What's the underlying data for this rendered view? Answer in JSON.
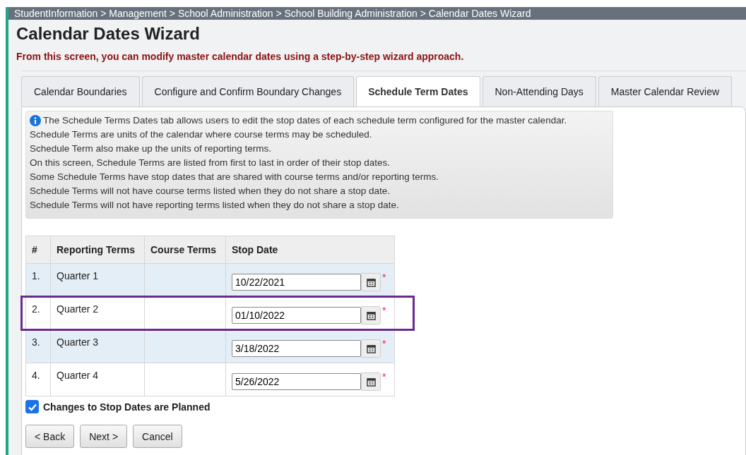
{
  "breadcrumb": "StudentInformation > Management > School Administration > School Building Administration > Calendar Dates Wizard",
  "title": "Calendar Dates Wizard",
  "subtitle": "From this screen, you can modify master calendar dates using a step-by-step wizard approach.",
  "tabs": [
    {
      "label": "Calendar Boundaries",
      "selected": false
    },
    {
      "label": "Configure and Confirm Boundary Changes",
      "selected": false
    },
    {
      "label": "Schedule Term Dates",
      "selected": true
    },
    {
      "label": "Non-Attending Days",
      "selected": false
    },
    {
      "label": "Master Calendar Review",
      "selected": false
    }
  ],
  "info_lines": [
    "The Schedule Terms Dates tab allows users to edit the stop dates of each schedule term configured for the master calendar.",
    "Schedule Terms are units of the calendar where course terms may be scheduled.",
    "Schedule Term also make up the units of reporting terms.",
    "On this screen, Schedule Terms are listed from first to last in order of their stop dates.",
    "Some Schedule Terms have stop dates that are shared with course terms and/or reporting terms.",
    "Schedule Terms will not have course terms listed when they do not share a stop date.",
    "Schedule Terms will not have reporting terms listed when they do not share a stop date."
  ],
  "table": {
    "columns": [
      "#",
      "Reporting Terms",
      "Course Terms",
      "Stop Date"
    ],
    "rows": [
      {
        "number": "1.",
        "reporting_term": "Quarter 1",
        "stop_date": "10/22/2021",
        "required": "*",
        "highlighted": false
      },
      {
        "number": "2.",
        "reporting_term": "Quarter 2",
        "stop_date": "01/10/2022",
        "required": "*",
        "highlighted": true
      },
      {
        "number": "3.",
        "reporting_term": "Quarter 3",
        "stop_date": "3/18/2022",
        "required": "*",
        "highlighted": false
      },
      {
        "number": "4.",
        "reporting_term": "Quarter 4",
        "stop_date": "5/26/2022",
        "required": "*",
        "highlighted": false
      }
    ]
  },
  "checkbox": {
    "label": "Changes to Stop Dates are Planned",
    "checked": true
  },
  "buttons": [
    "< Back",
    "Next >",
    "Cancel"
  ]
}
